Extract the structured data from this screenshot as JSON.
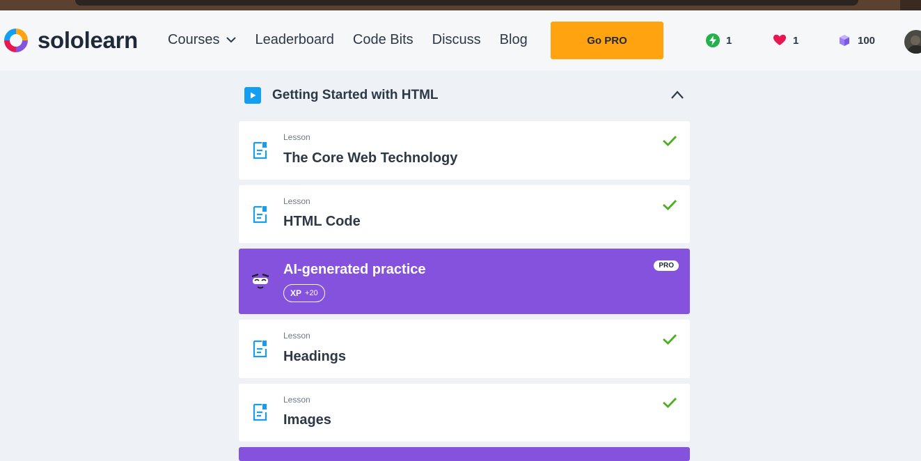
{
  "brand": {
    "name": "sololearn"
  },
  "nav": [
    {
      "label": "Courses",
      "has_dropdown": true
    },
    {
      "label": "Leaderboard"
    },
    {
      "label": "Code Bits"
    },
    {
      "label": "Discuss"
    },
    {
      "label": "Blog"
    }
  ],
  "go_pro": {
    "label": "Go PRO"
  },
  "stats": {
    "streak": {
      "icon": "lightning-icon",
      "value": "1",
      "color": "#24b14d"
    },
    "hearts": {
      "icon": "heart-icon",
      "value": "1",
      "color": "#e8174f"
    },
    "bits": {
      "icon": "cube-icon",
      "value": "100",
      "color": "#9b7ef5"
    }
  },
  "section": {
    "title": "Getting Started with HTML",
    "expanded": true
  },
  "items": [
    {
      "type": "lesson",
      "kind_label": "Lesson",
      "title": "The Core Web Technology",
      "completed": true
    },
    {
      "type": "lesson",
      "kind_label": "Lesson",
      "title": "HTML Code",
      "completed": true
    },
    {
      "type": "practice",
      "title": "AI-generated practice",
      "badge": "PRO",
      "xp_label": "XP",
      "xp_value": "+20"
    },
    {
      "type": "lesson",
      "kind_label": "Lesson",
      "title": "Headings",
      "completed": true
    },
    {
      "type": "lesson",
      "kind_label": "Lesson",
      "title": "Images",
      "completed": true
    }
  ],
  "colors": {
    "accent_orange": "#ffa310",
    "practice_purple": "#8552dd",
    "check_green": "#4caf1f",
    "lesson_icon_blue": "#149ef2"
  }
}
